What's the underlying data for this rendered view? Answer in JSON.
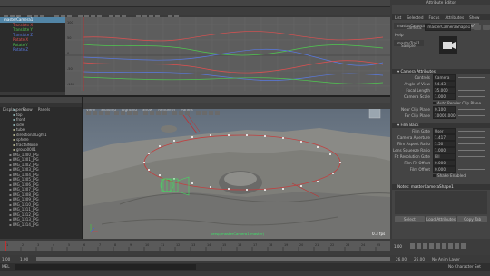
{
  "graph_editor": {
    "menu": [
      "Edit",
      "View",
      "Select",
      "Curves",
      "Keys",
      "Tangents",
      "List",
      "Show",
      "Panels"
    ],
    "outliner_items": [
      "masterCamera1",
      "Translate X",
      "Translate Y",
      "Translate Z",
      "Rotate X",
      "Rotate Y",
      "Rotate Z"
    ],
    "y_ticks": [
      "100",
      "50",
      "0",
      "-50",
      "-100"
    ],
    "colors": {
      "x": "#e05050",
      "y": "#50c850",
      "z": "#5a7ae0"
    }
  },
  "outliner": {
    "menu": [
      "Display",
      "Show",
      "Panels"
    ],
    "items": [
      "persp",
      "top",
      "front",
      "side",
      "tube",
      "directionalLight1",
      "sphere",
      "fractalNoise",
      "group0001",
      "IMG_1300_JPG",
      "IMG_1301_JPG",
      "IMG_1302_JPG",
      "IMG_1303_JPG",
      "IMG_1304_JPG",
      "IMG_1305_JPG",
      "IMG_1306_JPG",
      "IMG_1307_JPG",
      "IMG_1308_JPG",
      "IMG_1309_JPG",
      "IMG_1310_JPG",
      "IMG_1311_JPG",
      "IMG_1312_JPG",
      "IMG_1313_JPG",
      "IMG_1314_JPG"
    ]
  },
  "viewport": {
    "menu": [
      "View",
      "Shading",
      "Lighting",
      "Show",
      "Renderer",
      "Panels"
    ],
    "camera_label": "persp/masterCamera1(master)",
    "fps": "0.3 fps"
  },
  "attribute_editor": {
    "title": "Attribute Editor",
    "menu": [
      "List",
      "Selected",
      "Focus",
      "Attributes",
      "Show",
      "Help"
    ],
    "tabs": [
      "masterCamera1",
      "masterCameraShape1",
      "masterTrail1"
    ],
    "node_label": "camera:",
    "node_value": "masterCameraShape1",
    "sample_label": "Sample",
    "sections": {
      "camera": "Camera Attributes",
      "film": "Film Back",
      "notes": "Notes: masterCameraShape1"
    },
    "camera_attrs": [
      {
        "label": "Controls",
        "value": "Camera"
      },
      {
        "label": "Angle of View",
        "value": "54.43"
      },
      {
        "label": "Focal Length",
        "value": "35.000"
      },
      {
        "label": "Camera Scale",
        "value": "1.000"
      },
      {
        "label": "",
        "value": "Auto Render Clip Plane"
      },
      {
        "label": "Near Clip Plane",
        "value": "0.100"
      },
      {
        "label": "Far Clip Plane",
        "value": "10000.000"
      }
    ],
    "film_attrs": [
      {
        "label": "Film Gate",
        "value": "User"
      },
      {
        "label": "Camera Aperture",
        "value": "1.417"
      },
      {
        "label": "Film Aspect Ratio",
        "value": "1.50"
      },
      {
        "label": "Lens Squeeze Ratio",
        "value": "1.000"
      },
      {
        "label": "Fit Resolution Gate",
        "value": "Fill"
      },
      {
        "label": "Film Fit Offset",
        "value": "0.000"
      },
      {
        "label": "Film Offset",
        "value": "0.000"
      },
      {
        "label": "",
        "value": "Shake Enabled"
      }
    ],
    "buttons": [
      "Select",
      "Load Attributes",
      "Copy Tab"
    ]
  },
  "timeline": {
    "ticks": [
      "1",
      "2",
      "3",
      "4",
      "5",
      "6",
      "7",
      "8",
      "9",
      "10",
      "11",
      "12",
      "13",
      "14",
      "15",
      "16",
      "17",
      "18",
      "19",
      "20",
      "21",
      "22",
      "23",
      "24",
      "25"
    ],
    "current": "1.00",
    "range_start": "1.00",
    "range_end": "26.00",
    "end_frame": "26.00",
    "end_frame2": "26.00",
    "char_set": "No Character Set",
    "anim_layer": "No Anim Layer"
  },
  "command_line": {
    "prefix": "MEL"
  }
}
